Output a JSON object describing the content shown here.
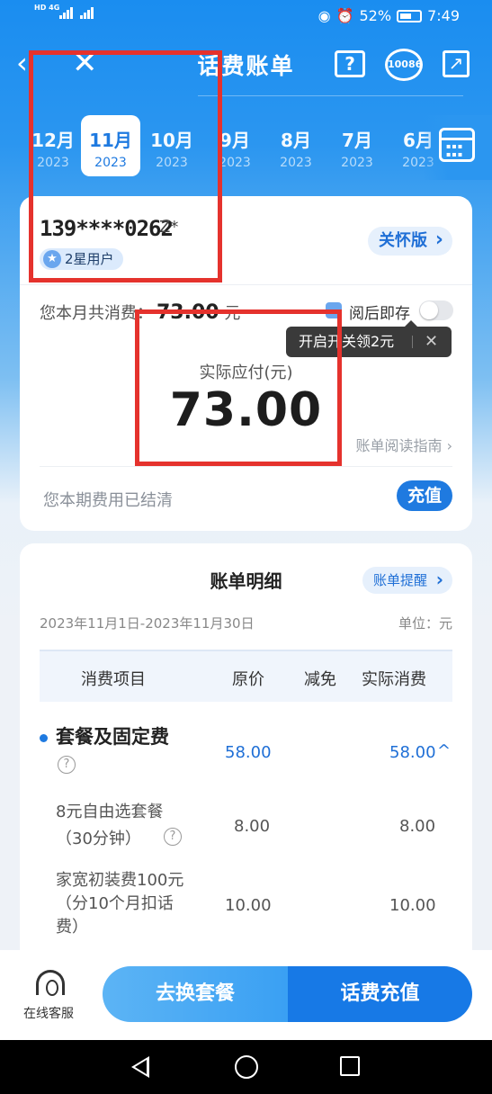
{
  "status_bar": {
    "left_text": "HD 4G",
    "battery": "52%",
    "time": "7:49"
  },
  "header": {
    "title": "话费账单",
    "help_label": "?",
    "service_number": "10086",
    "share_label": "↗"
  },
  "months": [
    {
      "month": "12月",
      "year": "2023"
    },
    {
      "month": "11月",
      "year": "2023",
      "active": true
    },
    {
      "month": "10月",
      "year": "2023"
    },
    {
      "month": "9月",
      "year": "2023"
    },
    {
      "month": "8月",
      "year": "2023"
    },
    {
      "month": "7月",
      "year": "2023"
    },
    {
      "month": "6月",
      "year": "2023"
    }
  ],
  "account": {
    "phone": "139****0262",
    "name": "Z*",
    "star_level": "2星用户",
    "care_button": "关怀版"
  },
  "bill": {
    "month_total_label": "您本月共消费：",
    "month_total_value": "73.00",
    "month_total_unit": "元",
    "save_label": "阅后即存",
    "tooltip_text": "开启开关领2元",
    "pay_label": "实际应付(元)",
    "pay_amount": "73.00",
    "guide_link": "账单阅读指南 ›",
    "settled_text": "您本期费用已结清",
    "recharge_button": "充值"
  },
  "details": {
    "title": "账单明细",
    "remind_button": "账单提醒",
    "period": "2023年11月1日-2023年11月30日",
    "unit": "单位：元",
    "columns": [
      "消费项目",
      "原价",
      "减免",
      "实际消费"
    ],
    "group": {
      "name": "套餐及固定费",
      "original": "58.00",
      "actual": "58.00",
      "expand_icon": "^"
    },
    "rows": [
      {
        "name_line1": "8元自由选套餐",
        "name_line2": "（30分钟）",
        "original": "8.00",
        "actual": "8.00"
      },
      {
        "name_line1": "家宽初装费100元",
        "name_line2": "（分10个月扣话",
        "name_line3": "费）",
        "original": "10.00",
        "actual": "10.00"
      }
    ]
  },
  "bottom_bar": {
    "service_label": "在线客服",
    "change_plan_button": "去换套餐",
    "topup_button": "话费充值"
  },
  "colors": {
    "primary_blue": "#1f7ae0",
    "annotation_red": "#e5322d"
  }
}
